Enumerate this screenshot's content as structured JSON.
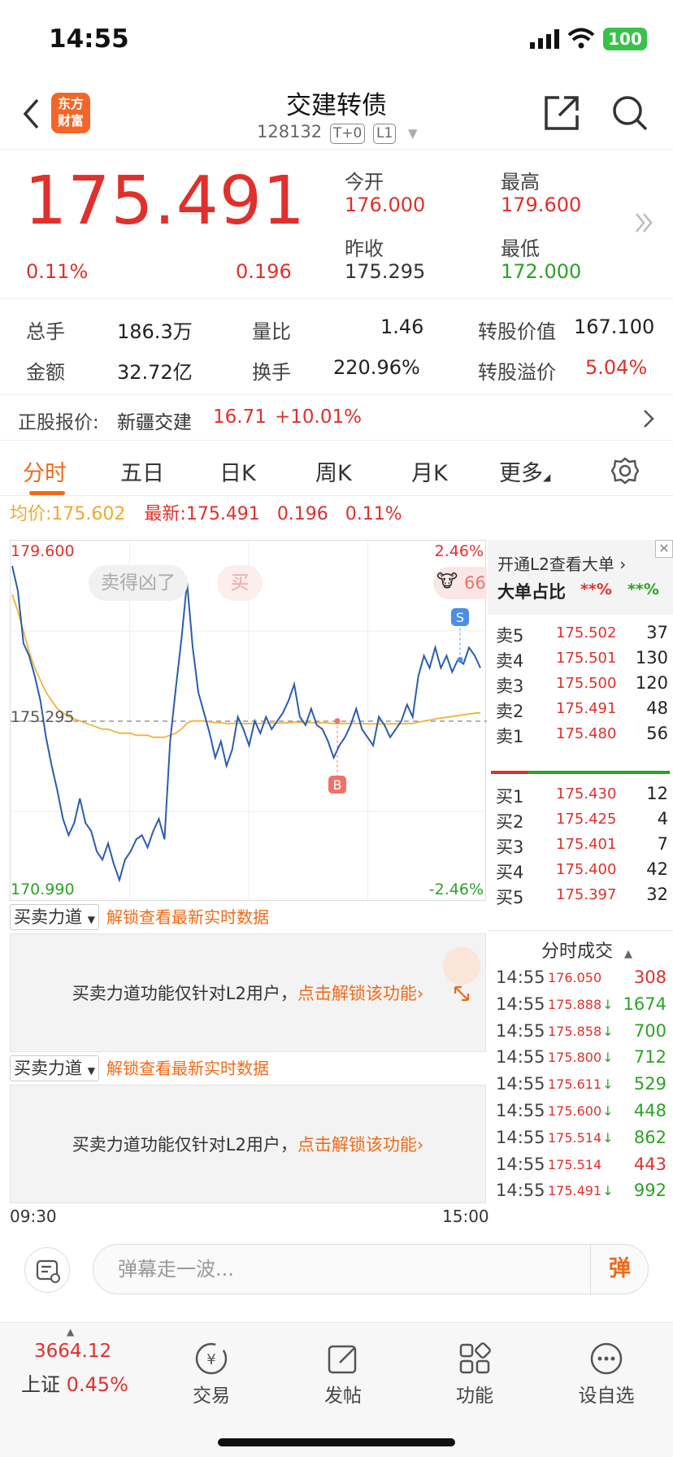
{
  "status": {
    "time": "14:55",
    "battery": "100"
  },
  "header": {
    "logo": "东方\n财富",
    "title": "交建转债",
    "code": "128132",
    "tag1": "T+0",
    "tag2": "L1"
  },
  "quote": {
    "price": "175.491",
    "change_pct": "0.11%",
    "change": "0.196",
    "open_label": "今开",
    "open": "176.000",
    "high_label": "最高",
    "high": "179.600",
    "prev_label": "昨收",
    "prev": "175.295",
    "low_label": "最低",
    "low": "172.000"
  },
  "stats": {
    "vol_label": "总手",
    "vol": "186.3万",
    "ratio_label": "量比",
    "ratio": "1.46",
    "conv_label": "转股价值",
    "conv": "167.100",
    "amt_label": "金额",
    "amt": "32.72亿",
    "turn_label": "换手",
    "turn": "220.96%",
    "prem_label": "转股溢价",
    "prem": "5.04%"
  },
  "stock": {
    "label": "正股报价:",
    "name": "新疆交建",
    "price": "16.71",
    "chg": "+10.01%"
  },
  "tabs": [
    "分时",
    "五日",
    "日K",
    "周K",
    "月K",
    "更多"
  ],
  "avg_line": {
    "avg_label": "均价:",
    "avg": "175.602",
    "last_label": "最新:",
    "last": "175.491",
    "chg": "0.196",
    "pct": "0.11%"
  },
  "chart": {
    "max": "179.600",
    "min": "170.990",
    "mid": "175.295",
    "pct_up": "2.46%",
    "pct_down": "-2.46%",
    "t_start": "09:30",
    "t_end": "15:00",
    "pill1": "卖得凶了",
    "pill2": "买",
    "badge": "66",
    "sell_marker": "S",
    "buy_marker": "B"
  },
  "chart_data": {
    "type": "line",
    "title": "",
    "xlabel": "",
    "ylabel": "",
    "x_range": [
      "09:30",
      "15:00"
    ],
    "ylim": [
      170.99,
      179.6
    ],
    "baseline": 175.295,
    "series": [
      {
        "name": "",
        "values": [
          179.1,
          178.5,
          177.2,
          176.9,
          176.4,
          175.8,
          174.9,
          174.2,
          173.6,
          172.9,
          172.5,
          172.8,
          173.4,
          172.8,
          172.6,
          172.1,
          171.9,
          172.3,
          171.8,
          171.4,
          171.9,
          172.1,
          172.4,
          172.5,
          172.2,
          172.6,
          172.9,
          172.4,
          174.8,
          176.1,
          177.3,
          178.7,
          177.1,
          176.0,
          175.5,
          175.0,
          174.4,
          174.8,
          174.2,
          174.6,
          175.4,
          175.1,
          174.7,
          175.3,
          175.0,
          175.4,
          175.1,
          175.3,
          175.5,
          175.8,
          176.2,
          175.4,
          175.2,
          175.6,
          175.2,
          175.1,
          174.8,
          174.4,
          174.7,
          174.9,
          175.2,
          175.6,
          175.1,
          174.9,
          174.7,
          175.4,
          175.2,
          174.9,
          175.1,
          175.3,
          175.7,
          175.4,
          176.4,
          176.9,
          176.6,
          177.1,
          176.6,
          176.9,
          176.5,
          176.8,
          176.7,
          177.1,
          176.9,
          176.6
        ]
      },
      {
        "name": "",
        "values": [
          178.4,
          178.0,
          177.5,
          177.0,
          176.6,
          176.3,
          176.0,
          175.8,
          175.6,
          175.5,
          175.4,
          175.35,
          175.3,
          175.25,
          175.2,
          175.15,
          175.1,
          175.1,
          175.05,
          175.0,
          175.0,
          175.0,
          174.95,
          174.95,
          174.95,
          174.9,
          174.9,
          174.9,
          174.95,
          175.0,
          175.1,
          175.25,
          175.3,
          175.3,
          175.3,
          175.28,
          175.26,
          175.26,
          175.24,
          175.24,
          175.24,
          175.24,
          175.24,
          175.24,
          175.24,
          175.25,
          175.25,
          175.25,
          175.25,
          175.26,
          175.27,
          175.27,
          175.26,
          175.26,
          175.26,
          175.26,
          175.25,
          175.24,
          175.24,
          175.24,
          175.24,
          175.24,
          175.24,
          175.23,
          175.23,
          175.23,
          175.23,
          175.23,
          175.23,
          175.23,
          175.24,
          175.24,
          175.27,
          175.3,
          175.32,
          175.35,
          175.37,
          175.39,
          175.41,
          175.43,
          175.45,
          175.47,
          175.49,
          175.5
        ]
      }
    ]
  },
  "panel": {
    "l2_title": "开通L2查看大单 ›",
    "big_label": "大单占比",
    "big1": "**%",
    "big2": "**%",
    "asks": [
      {
        "label": "卖5",
        "price": "175.502",
        "vol": "37"
      },
      {
        "label": "卖4",
        "price": "175.501",
        "vol": "130"
      },
      {
        "label": "卖3",
        "price": "175.500",
        "vol": "120"
      },
      {
        "label": "卖2",
        "price": "175.491",
        "vol": "48"
      },
      {
        "label": "卖1",
        "price": "175.480",
        "vol": "56"
      }
    ],
    "bids": [
      {
        "label": "买1",
        "price": "175.430",
        "vol": "12"
      },
      {
        "label": "买2",
        "price": "175.425",
        "vol": "4"
      },
      {
        "label": "买3",
        "price": "175.401",
        "vol": "7"
      },
      {
        "label": "买4",
        "price": "175.400",
        "vol": "42"
      },
      {
        "label": "买5",
        "price": "175.397",
        "vol": "32"
      }
    ],
    "trades_title": "分时成交",
    "trades": [
      {
        "t": "14:55",
        "p": "176.050",
        "v": "308",
        "dir": "up"
      },
      {
        "t": "14:55",
        "p": "175.888",
        "v": "1674",
        "dir": "down"
      },
      {
        "t": "14:55",
        "p": "175.858",
        "v": "700",
        "dir": "down"
      },
      {
        "t": "14:55",
        "p": "175.800",
        "v": "712",
        "dir": "down"
      },
      {
        "t": "14:55",
        "p": "175.611",
        "v": "529",
        "dir": "down"
      },
      {
        "t": "14:55",
        "p": "175.600",
        "v": "448",
        "dir": "down"
      },
      {
        "t": "14:55",
        "p": "175.514",
        "v": "862",
        "dir": "down"
      },
      {
        "t": "14:55",
        "p": "175.514",
        "v": "443",
        "dir": "up"
      },
      {
        "t": "14:55",
        "p": "175.491",
        "v": "992",
        "dir": "down"
      }
    ]
  },
  "indicators": {
    "dropdown": "买卖力道",
    "unlock": "解锁查看最新实时数据",
    "msg": "买卖力道功能仅针对L2用户，",
    "link": "点击解锁该功能›"
  },
  "input": {
    "placeholder": "弹幕走一波...",
    "btn": "弹"
  },
  "nav": {
    "index_value": "3664.12",
    "index_name": "上证",
    "index_pct": "0.45%",
    "items": [
      "交易",
      "发帖",
      "功能",
      "设自选"
    ]
  }
}
